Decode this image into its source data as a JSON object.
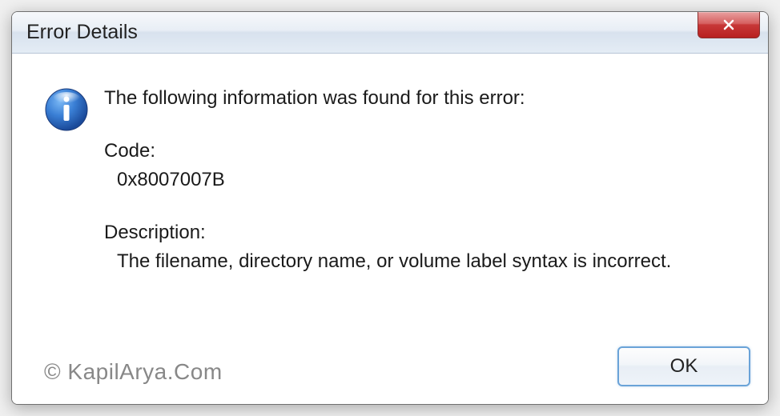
{
  "window": {
    "title": "Error Details"
  },
  "content": {
    "heading": "The following information was found for this error:",
    "code_label": "Code:",
    "code_value": "0x8007007B",
    "desc_label": "Description:",
    "desc_value": "The filename, directory name, or volume label syntax is incorrect."
  },
  "buttons": {
    "ok": "OK"
  },
  "watermark": "© KapilArya.Com"
}
